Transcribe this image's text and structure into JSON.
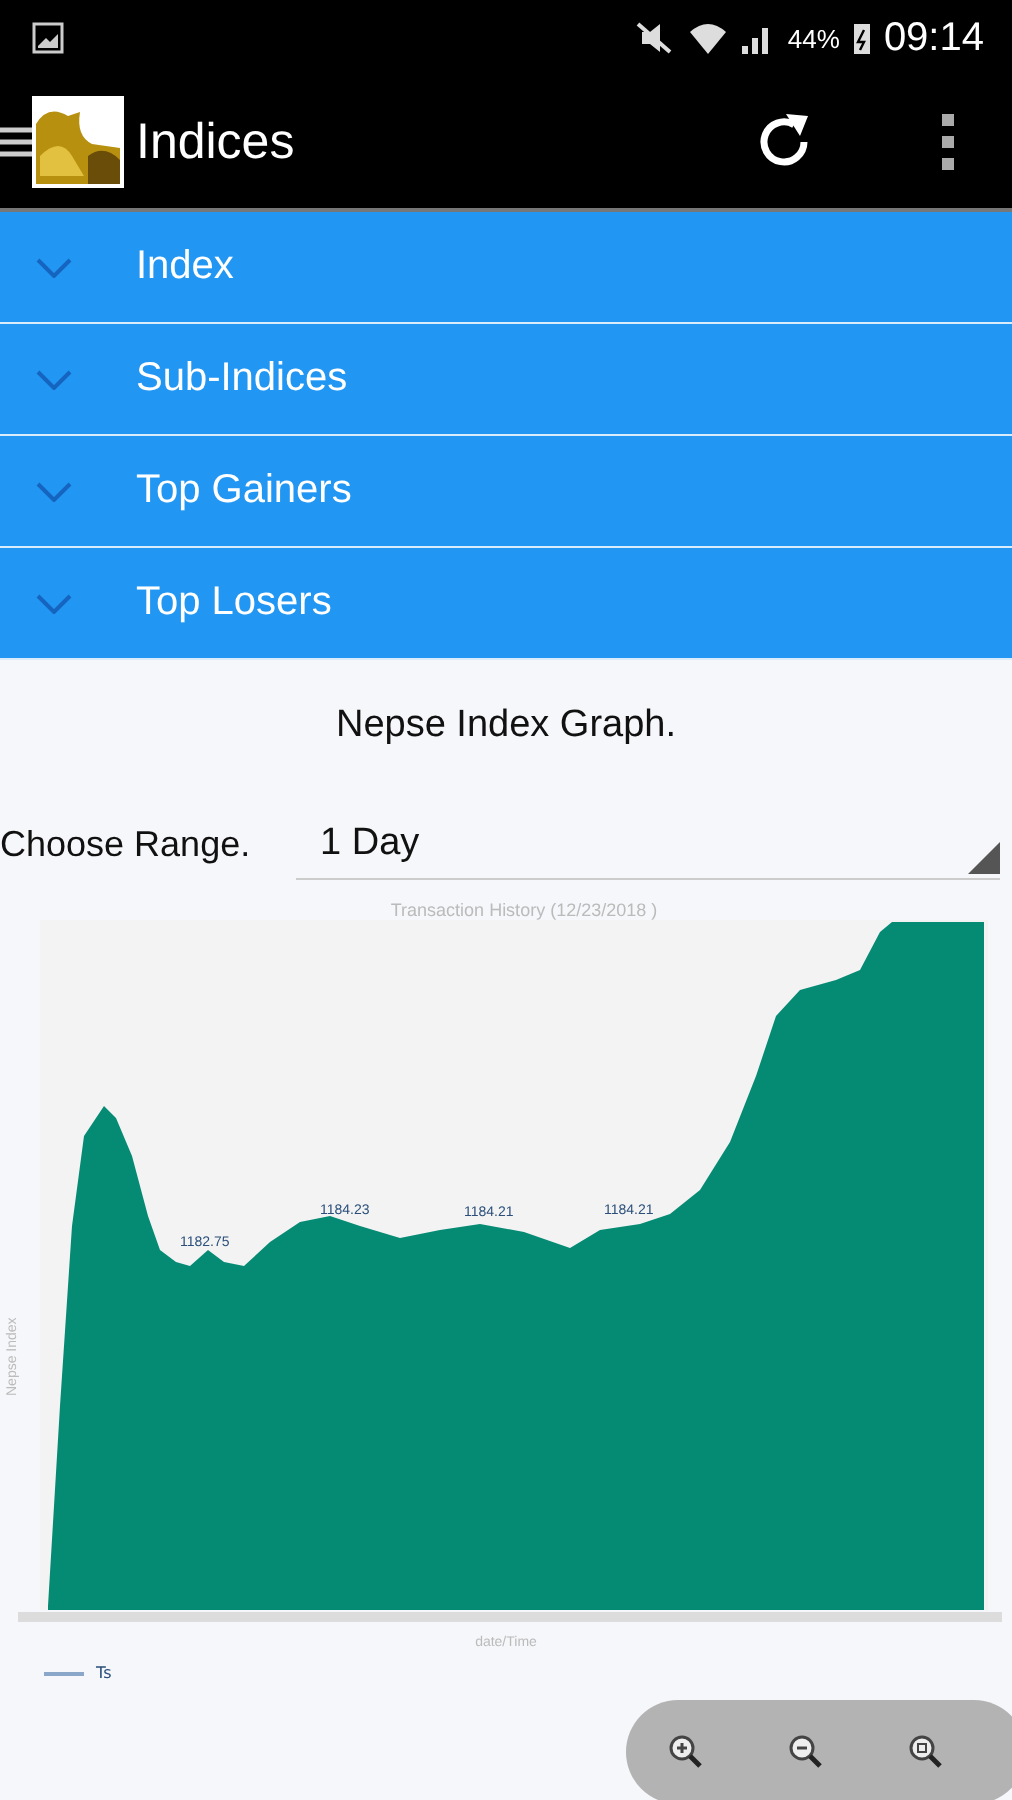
{
  "status_bar": {
    "battery": "44%",
    "time": "09:14"
  },
  "app_bar": {
    "title": "Indices"
  },
  "sections": [
    {
      "label": "Index",
      "expanded": false
    },
    {
      "label": "Sub-Indices",
      "expanded": false
    },
    {
      "label": "Top Gainers",
      "expanded": false
    },
    {
      "label": "Top Losers",
      "expanded": false
    }
  ],
  "graph": {
    "heading": "Nepse Index Graph.",
    "range_label": "Choose Range.",
    "range_value": "1 Day",
    "title": "Transaction History (12/23/2018 )",
    "ylabel": "Nepse Index",
    "xlabel": "date/Time",
    "legend": "Ts",
    "point_labels": [
      "1182.75",
      "1184.23",
      "1184.21",
      "1184.21"
    ]
  }
}
